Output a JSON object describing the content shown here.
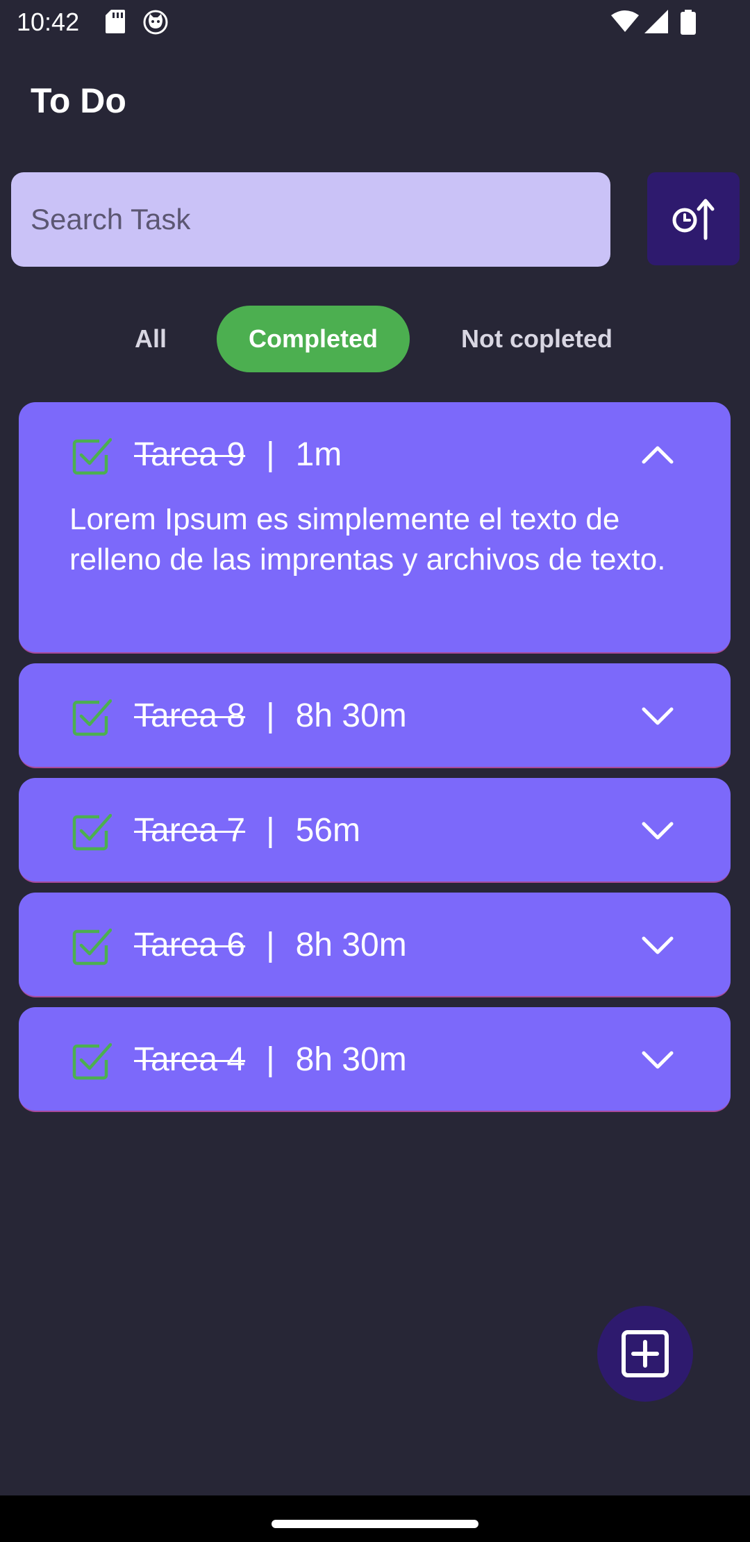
{
  "status_bar": {
    "time": "10:42"
  },
  "app": {
    "title": "To Do"
  },
  "search": {
    "placeholder": "Search Task",
    "value": ""
  },
  "sort_button": {
    "icon": "clock-sort-icon"
  },
  "tabs": [
    {
      "label": "All",
      "selected": false
    },
    {
      "label": "Completed",
      "selected": true
    },
    {
      "label": "Not copleted",
      "selected": false
    }
  ],
  "tasks": [
    {
      "name": "Tarea 9",
      "separator": "|",
      "duration": "1m",
      "completed": true,
      "expanded": true,
      "description": "Lorem Ipsum es simplemente el texto de relleno de las imprentas y archivos de texto."
    },
    {
      "name": "Tarea 8",
      "separator": "|",
      "duration": "8h 30m",
      "completed": true,
      "expanded": false
    },
    {
      "name": "Tarea 7",
      "separator": "|",
      "duration": "56m",
      "completed": true,
      "expanded": false
    },
    {
      "name": "Tarea 6",
      "separator": "|",
      "duration": "8h 30m",
      "completed": true,
      "expanded": false
    },
    {
      "name": "Tarea 4",
      "separator": "|",
      "duration": "8h 30m",
      "completed": true,
      "expanded": false
    }
  ],
  "fab": {
    "icon": "add-box-icon"
  },
  "colors": {
    "background": "#272636",
    "card": "#7c69fa",
    "search_bg": "#cac2f7",
    "accent_dark": "#2e1a6e",
    "completed_green": "#4caf50"
  }
}
